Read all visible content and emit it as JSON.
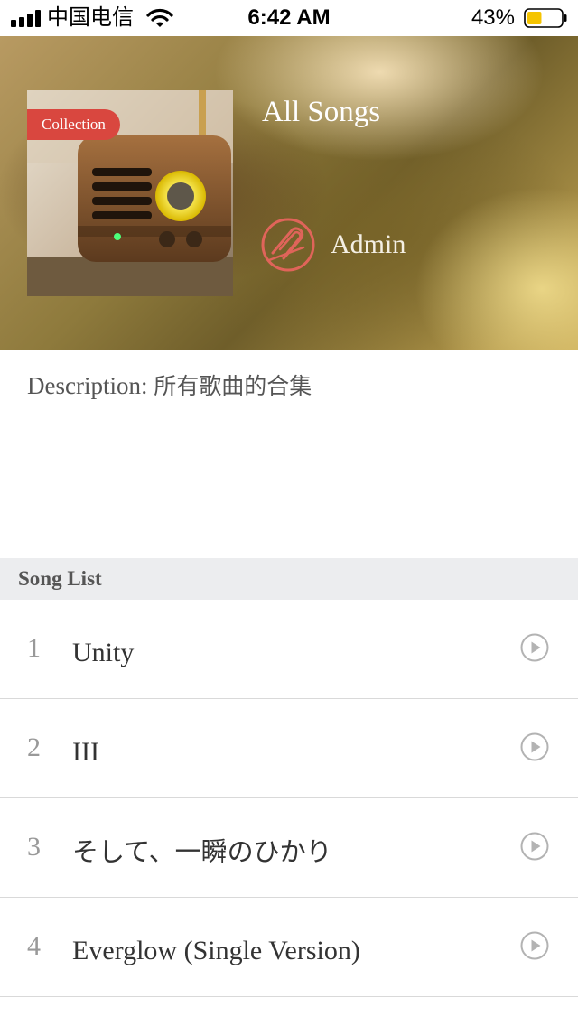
{
  "status_bar": {
    "carrier": "中国电信",
    "time": "6:42 AM",
    "battery_percent": "43%",
    "battery_level": 0.43,
    "icons": [
      "signal-icon",
      "wifi-icon",
      "battery-icon"
    ]
  },
  "header": {
    "badge": "Collection",
    "title": "All Songs",
    "creator": "Admin",
    "creator_icon": "creator-logo-icon"
  },
  "description": {
    "label": "Description: ",
    "text": "所有歌曲的合集"
  },
  "song_list": {
    "heading": "Song List",
    "play_icon": "play-circle-icon",
    "songs": [
      {
        "index": "1",
        "title": "Unity"
      },
      {
        "index": "2",
        "title": "III"
      },
      {
        "index": "3",
        "title": "そして、一瞬のひかり"
      },
      {
        "index": "4",
        "title": "Everglow (Single Version)"
      }
    ]
  },
  "colors": {
    "badge": "#d9473f",
    "section_header_bg": "#ecedef",
    "divider": "#d9d9d9",
    "battery_fill": "#f5c400"
  }
}
